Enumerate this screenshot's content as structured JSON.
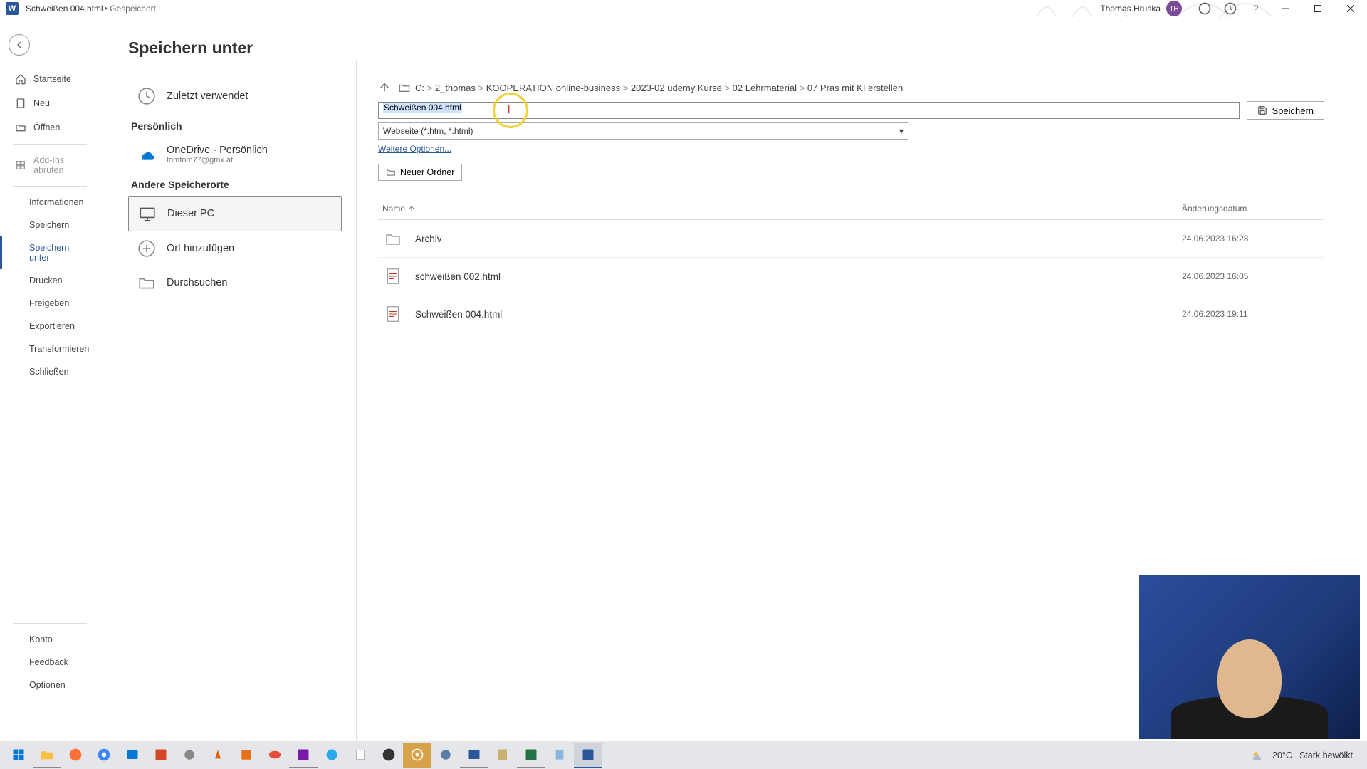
{
  "titlebar": {
    "doc_title": "Schweißen 004.html",
    "doc_status": "Gespeichert",
    "user_name": "Thomas Hruska",
    "user_initials": "TH"
  },
  "sidebar": {
    "items": [
      {
        "icon": "home",
        "label": "Startseite"
      },
      {
        "icon": "new",
        "label": "Neu"
      },
      {
        "icon": "open",
        "label": "Öffnen"
      },
      {
        "icon": "addins",
        "label": "Add-Ins abrufen"
      },
      {
        "icon": "",
        "label": "Informationen"
      },
      {
        "icon": "",
        "label": "Speichern"
      },
      {
        "icon": "",
        "label": "Speichern unter"
      },
      {
        "icon": "",
        "label": "Drucken"
      },
      {
        "icon": "",
        "label": "Freigeben"
      },
      {
        "icon": "",
        "label": "Exportieren"
      },
      {
        "icon": "",
        "label": "Transformieren"
      },
      {
        "icon": "",
        "label": "Schließen"
      }
    ],
    "bottom": [
      {
        "label": "Konto"
      },
      {
        "label": "Feedback"
      },
      {
        "label": "Optionen"
      }
    ]
  },
  "middle": {
    "page_title": "Speichern unter",
    "recent_label": "Zuletzt verwendet",
    "personal_header": "Persönlich",
    "onedrive_label": "OneDrive - Persönlich",
    "onedrive_sub": "tomtom77@gmx.at",
    "other_header": "Andere Speicherorte",
    "this_pc_label": "Dieser PC",
    "add_place_label": "Ort hinzufügen",
    "browse_label": "Durchsuchen"
  },
  "filepanel": {
    "breadcrumb": [
      "C:",
      "2_thomas",
      "KOOPERATION online-business",
      "2023-02 udemy Kurse",
      "02 Lehrmaterial",
      "07 Präs mit KI erstellen"
    ],
    "filename_value": "Schweißen 004.html",
    "filetype_value": "Webseite (*.htm, *.html)",
    "save_btn": "Speichern",
    "more_options": "Weitere Optionen...",
    "new_folder": "Neuer Ordner",
    "col_name": "Name",
    "col_date": "Änderungsdatum",
    "rows": [
      {
        "type": "folder",
        "name": "Archiv",
        "date": "24.06.2023 16:28"
      },
      {
        "type": "html",
        "name": "schweißen 002.html",
        "date": "24.06.2023 16:05"
      },
      {
        "type": "html",
        "name": "Schweißen 004.html",
        "date": "24.06.2023 19:11"
      }
    ]
  },
  "taskbar": {
    "temp": "20°C",
    "weather_text": "Stark bewölkt"
  }
}
